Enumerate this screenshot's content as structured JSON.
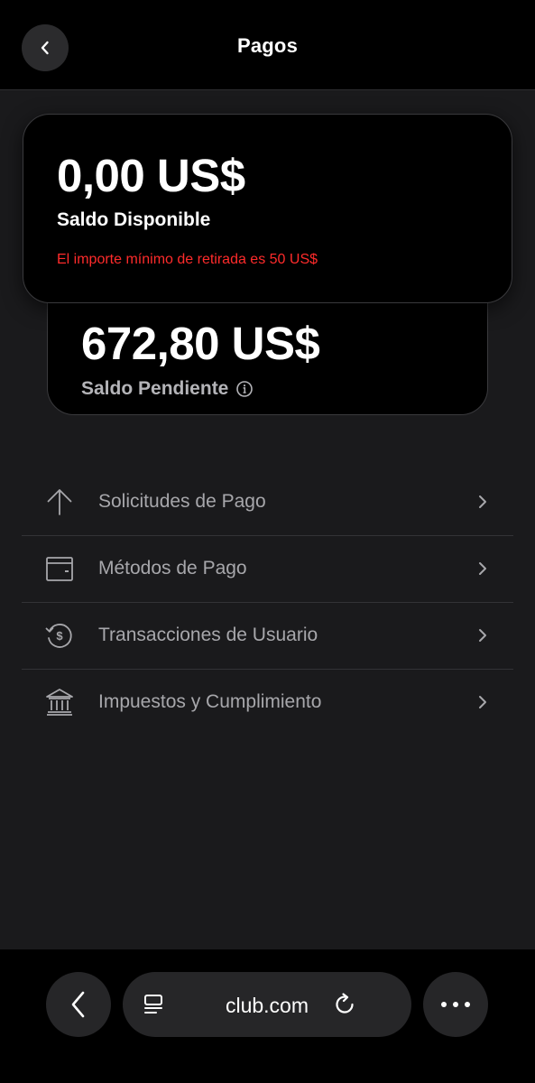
{
  "header": {
    "title": "Pagos",
    "back_icon": "chevron-left-icon"
  },
  "balances": {
    "available": {
      "amount": "0,00 US$",
      "label": "Saldo Disponible",
      "warning": "El importe mínimo de retirada es 50 US$",
      "warning_color": "#ff2b2b"
    },
    "pending": {
      "amount": "672,80 US$",
      "label": "Saldo Pendiente",
      "info_icon": "info-icon"
    }
  },
  "menu": {
    "items": [
      {
        "label": "Solicitudes de Pago",
        "icon": "arrow-up-icon"
      },
      {
        "label": "Métodos de Pago",
        "icon": "wallet-icon"
      },
      {
        "label": "Transacciones de Usuario",
        "icon": "dollar-refresh-icon"
      },
      {
        "label": "Impuestos y Cumplimiento",
        "icon": "bank-icon"
      }
    ]
  },
  "browser": {
    "url": "club.com",
    "back_icon": "chevron-left-icon",
    "tabs_icon": "tabs-icon",
    "reload_icon": "reload-icon",
    "more_icon": "more-icon"
  },
  "colors": {
    "background": "#1a1a1c",
    "card": "#000000",
    "muted_text": "#a7a7ab",
    "warning": "#ff2b2b"
  }
}
